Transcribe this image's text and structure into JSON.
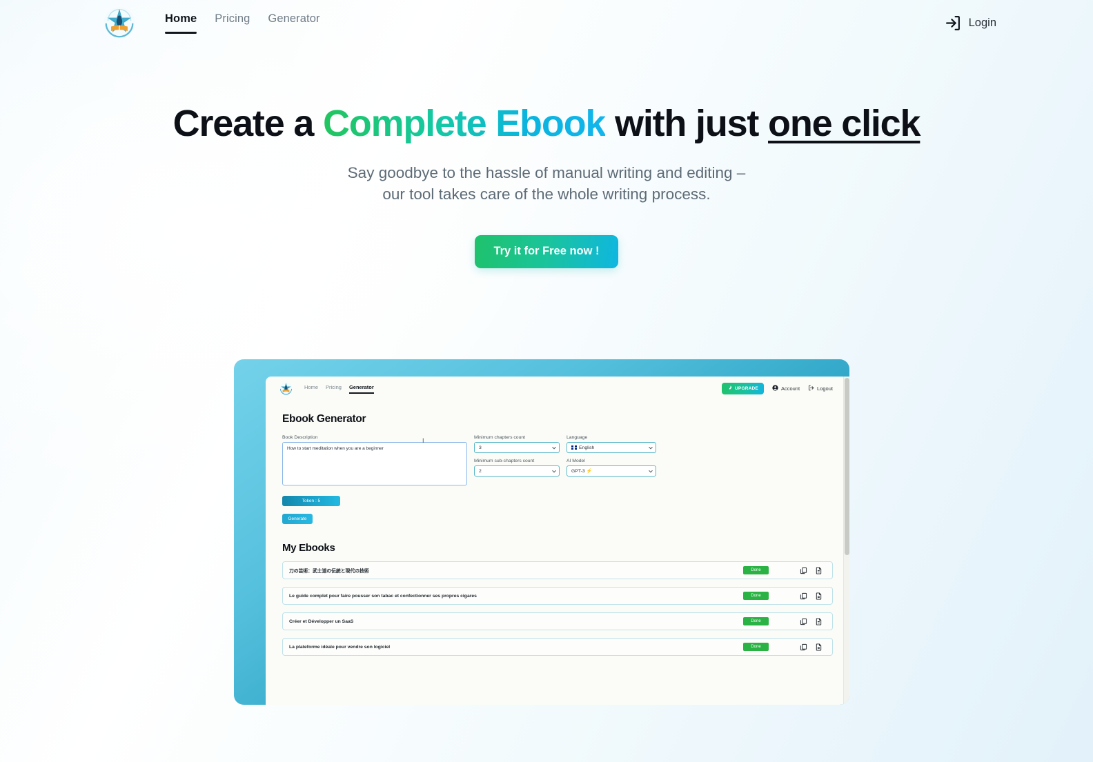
{
  "nav": {
    "logo_icon": "ebook-star-logo",
    "links": [
      {
        "label": "Home",
        "active": true
      },
      {
        "label": "Pricing",
        "active": false
      },
      {
        "label": "Generator",
        "active": false
      }
    ],
    "login": {
      "label": "Login",
      "icon": "sign-in-icon"
    }
  },
  "hero": {
    "headline_part1": "Create a ",
    "headline_gradient": "Complete Ebook",
    "headline_part2": " with just ",
    "headline_underlined": "one click",
    "subhead_line1": "Say goodbye to the hassle of manual writing and editing –",
    "subhead_line2": "our tool takes care of the whole writing process.",
    "cta_label": "Try it for Free now !",
    "gradient_start": "#22c55e",
    "gradient_end": "#12b5ec"
  },
  "mockup": {
    "frame_color_start": "#74d2ea",
    "frame_color_end": "#1b8cae",
    "nav": {
      "logo_icon": "ebook-star-logo",
      "links": [
        {
          "label": "Home",
          "active": false
        },
        {
          "label": "Pricing",
          "active": false
        },
        {
          "label": "Generator",
          "active": true
        }
      ],
      "upgrade_label": "UPGRADE",
      "upgrade_icon": "rocket-icon",
      "account_label": "Account",
      "account_icon": "user-circle-icon",
      "logout_label": "Logout",
      "logout_icon": "sign-out-icon"
    },
    "generator": {
      "title": "Ebook Generator",
      "book_description_label": "Book Description",
      "book_description_value": "How to start meditation when you are a beginner",
      "min_chapters_label": "Minimum chapters count",
      "min_chapters_value": "3",
      "min_subchapters_label": "Minimum sub-chapters count",
      "min_subchapters_value": "2",
      "language_label": "Language",
      "language_value": "English",
      "language_flag": "uk-flag-icon",
      "ai_model_label": "AI Model",
      "ai_model_value": "GPT-3 ⚡",
      "token_label": "Token : 5",
      "generate_label": "Generate"
    },
    "ebooks": {
      "title": "My Ebooks",
      "status_label": "Done",
      "icons": [
        "copy-icon",
        "document-icon"
      ],
      "rows": [
        {
          "title": "刀の芸術：武士道の伝統と現代の技術",
          "status": "Done"
        },
        {
          "title": "Le guide complet pour faire pousser son tabac et confectionner ses propres cigares",
          "status": "Done"
        },
        {
          "title": "Créer et Développer un SaaS",
          "status": "Done"
        },
        {
          "title": "La plateforme idéale pour vendre son logiciel",
          "status": "Done"
        }
      ]
    }
  }
}
